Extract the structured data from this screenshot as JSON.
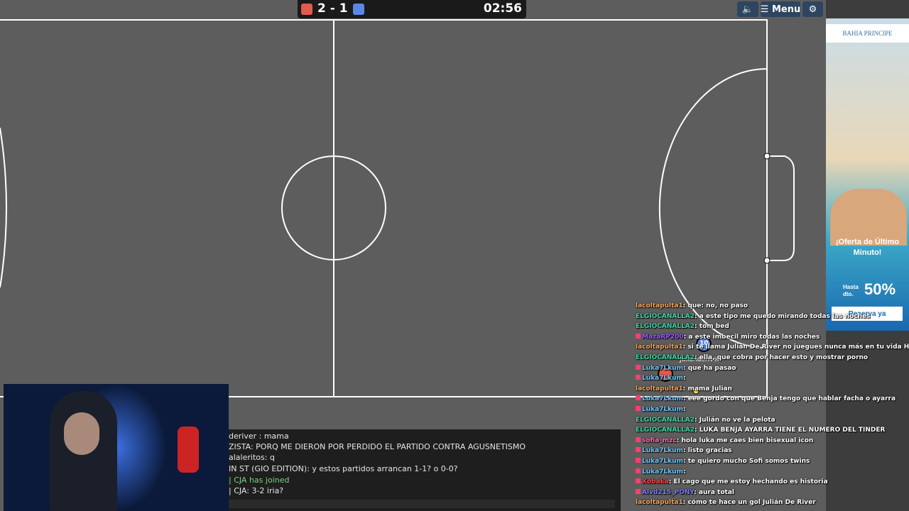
{
  "scoreboard": {
    "score": "2 - 1",
    "timer": "02:56",
    "red_color": "#e35a4f",
    "blue_color": "#5b86e5"
  },
  "toolbar": {
    "menu_label": "Menu"
  },
  "players": [
    {
      "label": "Julianderiver",
      "number": "10",
      "team": "blue"
    }
  ],
  "ad": {
    "brand": "BAHIA PRINCIPE",
    "offer_line1": "¡Oferta de Último",
    "offer_line2": "Minuto!",
    "hasta": "Hasta",
    "dto": "dto.",
    "percent": "50%",
    "cta": "Reserva ya"
  },
  "game_chat": [
    {
      "text": "deriver : mama",
      "type": "msg"
    },
    {
      "text": "ZISTA: PORQ ME DIERON POR PERDIDO EL PARTIDO CONTRA AGUSNETISMO",
      "type": "msg"
    },
    {
      "text": "alaleritos: q",
      "type": "msg"
    },
    {
      "text": "IN ST (GIO EDITION): y estos partidos arrancan 1-1? o 0-0?",
      "type": "msg"
    },
    {
      "text": "| CJA has joined",
      "type": "join"
    },
    {
      "text": "| CJA: 3-2 iria?",
      "type": "msg"
    }
  ],
  "stream_chat": [
    {
      "user": "lacoltapulta1",
      "color": "#f3a65a",
      "text": "que: no, no paso",
      "badge": false
    },
    {
      "user": "ELGIOCANALLA2",
      "color": "#3bd6a0",
      "text": "a este tipo me quedo mirando todas las noches",
      "badge": false
    },
    {
      "user": "ELGIOCANALLA2",
      "color": "#3bd6a0",
      "text": "tom bed",
      "badge": false
    },
    {
      "user": "MazaRP200",
      "color": "#9b59ff",
      "text": "a este imbecil miro todas las noches",
      "badge": true
    },
    {
      "user": "lacoltapulta1",
      "color": "#f3a65a",
      "text": "si te llama Julián De River no juegues nunca más en tu vida Hax",
      "badge": false
    },
    {
      "user": "ELGIOCANALLA2",
      "color": "#3bd6a0",
      "text": "ella, que cobra por hacer esto y mostrar porno",
      "badge": false
    },
    {
      "user": "Luka7Lkum",
      "color": "#6ec6ff",
      "text": "que ha pasao",
      "badge": true
    },
    {
      "user": "Luka7Lkum",
      "color": "#6ec6ff",
      "text": "",
      "badge": true
    },
    {
      "user": "lacoltapulta1",
      "color": "#f3a65a",
      "text": "mama Julian",
      "badge": false
    },
    {
      "user": "Luka7Lkum",
      "color": "#6ec6ff",
      "text": "eee gordo con que Benja tengo que hablar facha o ayarra",
      "badge": true
    },
    {
      "user": "Luka7Lkum",
      "color": "#6ec6ff",
      "text": "",
      "badge": true
    },
    {
      "user": "ELGIOCANALLA2",
      "color": "#3bd6a0",
      "text": "Julián no ve la pelota",
      "badge": false
    },
    {
      "user": "ELGIOCANALLA2",
      "color": "#3bd6a0",
      "text": "LUKA BENJA AYARRA TIENE EL NUMERO DEL TINDER",
      "badge": false
    },
    {
      "user": "sofia_mzc",
      "color": "#ff6ab4",
      "text": "hola luka me caes bien bisexual icon",
      "badge": true
    },
    {
      "user": "Luka7Lkum",
      "color": "#6ec6ff",
      "text": "listo gracias",
      "badge": true
    },
    {
      "user": "Luka7Lkum",
      "color": "#6ec6ff",
      "text": "te quiero mucho Sofi somos twins",
      "badge": true
    },
    {
      "user": "Luka7Lkum",
      "color": "#6ec6ff",
      "text": "",
      "badge": true
    },
    {
      "user": "Xobaka",
      "color": "#ff4040",
      "text": "El cago que me estoy hechando es historia",
      "badge": true
    },
    {
      "user": "Alvd215_PONY",
      "color": "#7c7cff",
      "text": "aura total",
      "badge": true
    },
    {
      "user": "lacoltapulta1",
      "color": "#f3a65a",
      "text": "cómo te hace un gol Julián De River",
      "badge": false
    }
  ]
}
